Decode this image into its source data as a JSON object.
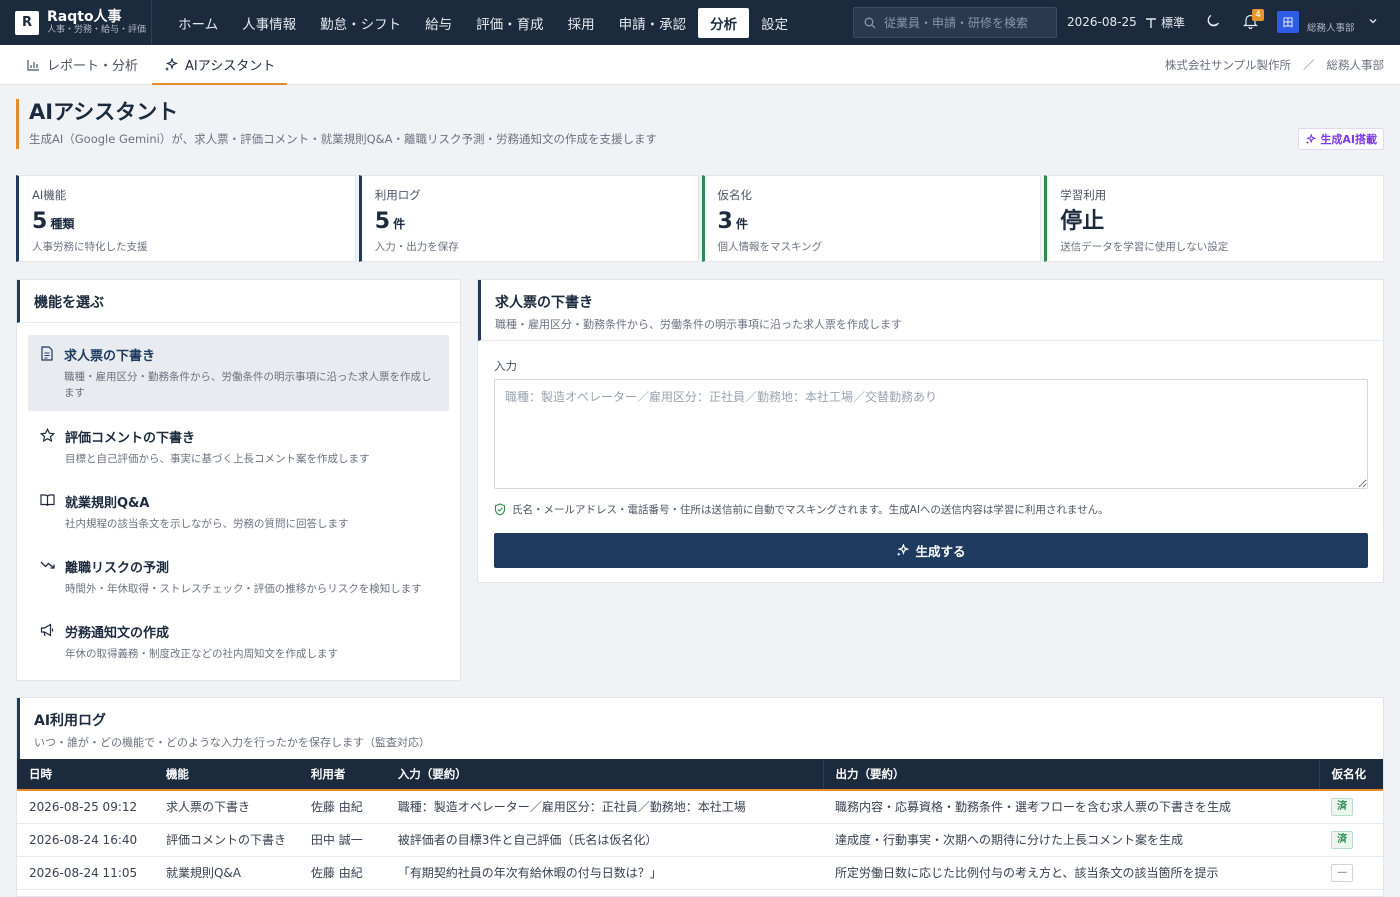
{
  "app": {
    "logo_letter": "R",
    "name": "Raqto人事",
    "tagline": "人事・労務・給与・評価"
  },
  "nav": [
    {
      "label": "ホーム",
      "active": false
    },
    {
      "label": "人事情報",
      "active": false
    },
    {
      "label": "勤怠・シフト",
      "active": false
    },
    {
      "label": "給与",
      "active": false
    },
    {
      "label": "評価・育成",
      "active": false
    },
    {
      "label": "採用",
      "active": false
    },
    {
      "label": "申請・承認",
      "active": false
    },
    {
      "label": "分析",
      "active": true
    },
    {
      "label": "設定",
      "active": false
    }
  ],
  "search": {
    "placeholder": "従業員・申請・研修を検索"
  },
  "topbar": {
    "date": "2026-08-25",
    "font_size_label": "標準",
    "notification_count": "4"
  },
  "user": {
    "avatar": "田",
    "name": "田中 誠一",
    "dept": "総務人事部"
  },
  "subtabs": [
    {
      "label": "レポート・分析",
      "icon": "bar-chart-icon",
      "active": false
    },
    {
      "label": "AIアシスタント",
      "icon": "sparkle-icon",
      "active": true
    }
  ],
  "breadcrumb": {
    "company": "株式会社サンプル製作所",
    "separator": "／",
    "dept": "総務人事部"
  },
  "page": {
    "title": "AIアシスタント",
    "description": "生成AI（Google Gemini）が、求人票・評価コメント・就業規則Q&A・離職リスク予測・労務通知文の作成を支援します",
    "tag": "生成AI搭載"
  },
  "stats": [
    {
      "label": "AI機能",
      "value": "5",
      "unit": "種類",
      "note": "人事労務に特化した支援"
    },
    {
      "label": "利用ログ",
      "value": "5",
      "unit": "件",
      "note": "入力・出力を保存"
    },
    {
      "label": "仮名化",
      "value": "3",
      "unit": "件",
      "note": "個人情報をマスキング"
    },
    {
      "label": "学習利用",
      "value": "停止",
      "unit": "",
      "note": "送信データを学習に使用しない設定"
    }
  ],
  "features_panel": {
    "title": "機能を選ぶ",
    "items": [
      {
        "name": "求人票の下書き",
        "desc": "職種・雇用区分・勤務条件から、労働条件の明示事項に沿った求人票を作成します",
        "icon": "document-icon",
        "active": true
      },
      {
        "name": "評価コメントの下書き",
        "desc": "目標と自己評価から、事実に基づく上長コメント案を作成します",
        "icon": "star-icon",
        "active": false
      },
      {
        "name": "就業規則Q&A",
        "desc": "社内規程の該当条文を示しながら、労務の質問に回答します",
        "icon": "book-icon",
        "active": false
      },
      {
        "name": "離職リスクの予測",
        "desc": "時間外・年休取得・ストレスチェック・評価の推移からリスクを検知します",
        "icon": "trend-down-icon",
        "active": false
      },
      {
        "name": "労務通知文の作成",
        "desc": "年休の取得義務・制度改正などの社内周知文を作成します",
        "icon": "megaphone-icon",
        "active": false
      }
    ]
  },
  "editor": {
    "title": "求人票の下書き",
    "description": "職種・雇用区分・勤務条件から、労働条件の明示事項に沿った求人票を作成します",
    "input_label": "入力",
    "placeholder": "職種：製造オペレーター／雇用区分：正社員／勤務地：本社工場／交替勤務あり",
    "value": "",
    "privacy_note": "氏名・メールアドレス・電話番号・住所は送信前に自動でマスキングされます。生成AIへの送信内容は学習に利用されません。",
    "generate_label": "生成する"
  },
  "log": {
    "title": "AI利用ログ",
    "description": "いつ・誰が・どの機能で・どのような入力を行ったかを保存します（監査対応）",
    "columns": [
      "日時",
      "機能",
      "利用者",
      "入力（要約）",
      "出力（要約）",
      "仮名化"
    ],
    "rows": [
      {
        "datetime": "2026-08-25 09:12",
        "feature": "求人票の下書き",
        "user": "佐藤 由紀",
        "input": "職種：製造オペレーター／雇用区分：正社員／勤務地：本社工場",
        "output": "職務内容・応募資格・勤務条件・選考フローを含む求人票の下書きを生成",
        "masked": "済"
      },
      {
        "datetime": "2026-08-24 16:40",
        "feature": "評価コメントの下書き",
        "user": "田中 誠一",
        "input": "被評価者の目標3件と自己評価（氏名は仮名化）",
        "output": "達成度・行動事実・次期への期待に分けた上長コメント案を生成",
        "masked": "済"
      },
      {
        "datetime": "2026-08-24 11:05",
        "feature": "就業規則Q&A",
        "user": "佐藤 由紀",
        "input": "「有期契約社員の年次有給休暇の付与日数は？」",
        "output": "所定労働日数に応じた比例付与の考え方と、該当条文の該当箇所を提示",
        "masked": "—"
      }
    ]
  }
}
